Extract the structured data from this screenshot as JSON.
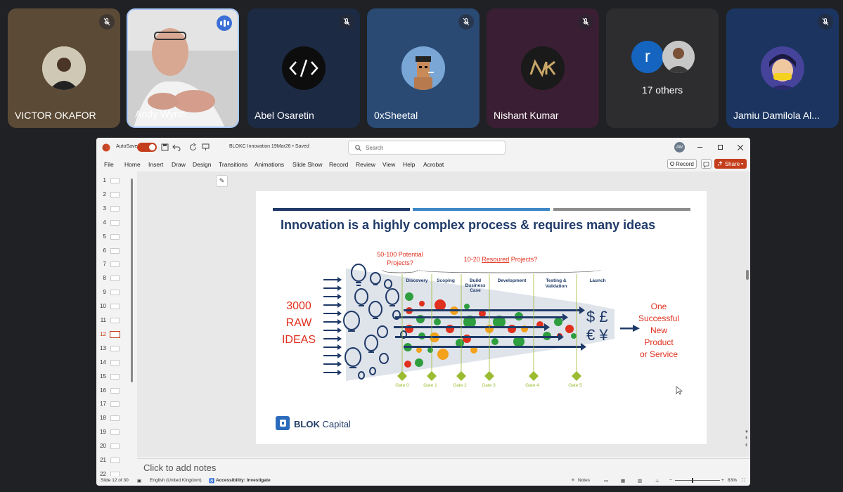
{
  "participants": [
    {
      "name": "VICTOR OKAFOR",
      "muted": true,
      "bg": "#5b4a35"
    },
    {
      "name": "Andy Wynn",
      "speaking": true
    },
    {
      "name": "Abel Osaretin",
      "muted": true,
      "bg": "#1c2a44"
    },
    {
      "name": "0xSheetal",
      "muted": true,
      "bg": "#2a4a74"
    },
    {
      "name": "Nishant Kumar",
      "muted": true,
      "bg": "#3a1e33"
    },
    {
      "others_initial": "r",
      "others_label": "17 others",
      "bg": "#2d2d30"
    },
    {
      "name": "Jamiu Damilola Al...",
      "muted": true,
      "bg": "#1b3560"
    }
  ],
  "ppt": {
    "autosave_label": "AutoSave",
    "doc_title": "BLOKC Innovation 19Mar26 • Saved",
    "search_placeholder": "Search",
    "user_initials": "AW",
    "menu": [
      "File",
      "Home",
      "Insert",
      "Draw",
      "Design",
      "Transitions",
      "Animations",
      "Slide Show",
      "Record",
      "Review",
      "View",
      "Help",
      "Acrobat"
    ],
    "record_label": "Record",
    "share_label": "Share",
    "thumb_numbers": [
      "1",
      "2",
      "3",
      "4",
      "5",
      "6",
      "7",
      "8",
      "9",
      "10",
      "11",
      "12",
      "13",
      "14",
      "15",
      "16",
      "17",
      "18",
      "19",
      "20",
      "21",
      "22"
    ],
    "selected_slide": "12",
    "notes_placeholder": "Click to add notes",
    "status": {
      "slide_count": "Slide 12 of 30",
      "language": "English (United Kingdom)",
      "accessibility": "Accessibility: Investigate",
      "notes": "Notes",
      "zoom": "83%"
    }
  },
  "slide": {
    "title": "Innovation is a highly complex process & requires many ideas",
    "left_label": [
      "3000",
      "RAW",
      "IDEAS"
    ],
    "potential_label": [
      "50-100 Potential",
      "Projects?"
    ],
    "resourced_prefix": "10-20 ",
    "resourced_word": "Resoured",
    "resourced_suffix": " Projects?",
    "stages": [
      [
        "Discovery"
      ],
      [
        "Scoping"
      ],
      [
        "Build",
        "Business",
        "Case"
      ],
      [
        "Development"
      ],
      [
        "Testing &",
        "Validation"
      ],
      [
        "Launch"
      ]
    ],
    "gates": [
      "Gate 0",
      "Gate 1",
      "Gate 2",
      "Gate 3",
      "Gate 4",
      "Gate 5"
    ],
    "currency_top": "$ £",
    "currency_bottom": "€ ¥",
    "outcome": [
      "One",
      "Successful",
      "New",
      "Product",
      "or Service"
    ],
    "logo_bold": "BLOK",
    "logo_rest": " Capital",
    "colors": {
      "navy": "#1f3a68",
      "blue": "#3d87c7",
      "grey": "#8c8c8c",
      "red": "#e0301e",
      "olive": "#9bbb31"
    }
  }
}
